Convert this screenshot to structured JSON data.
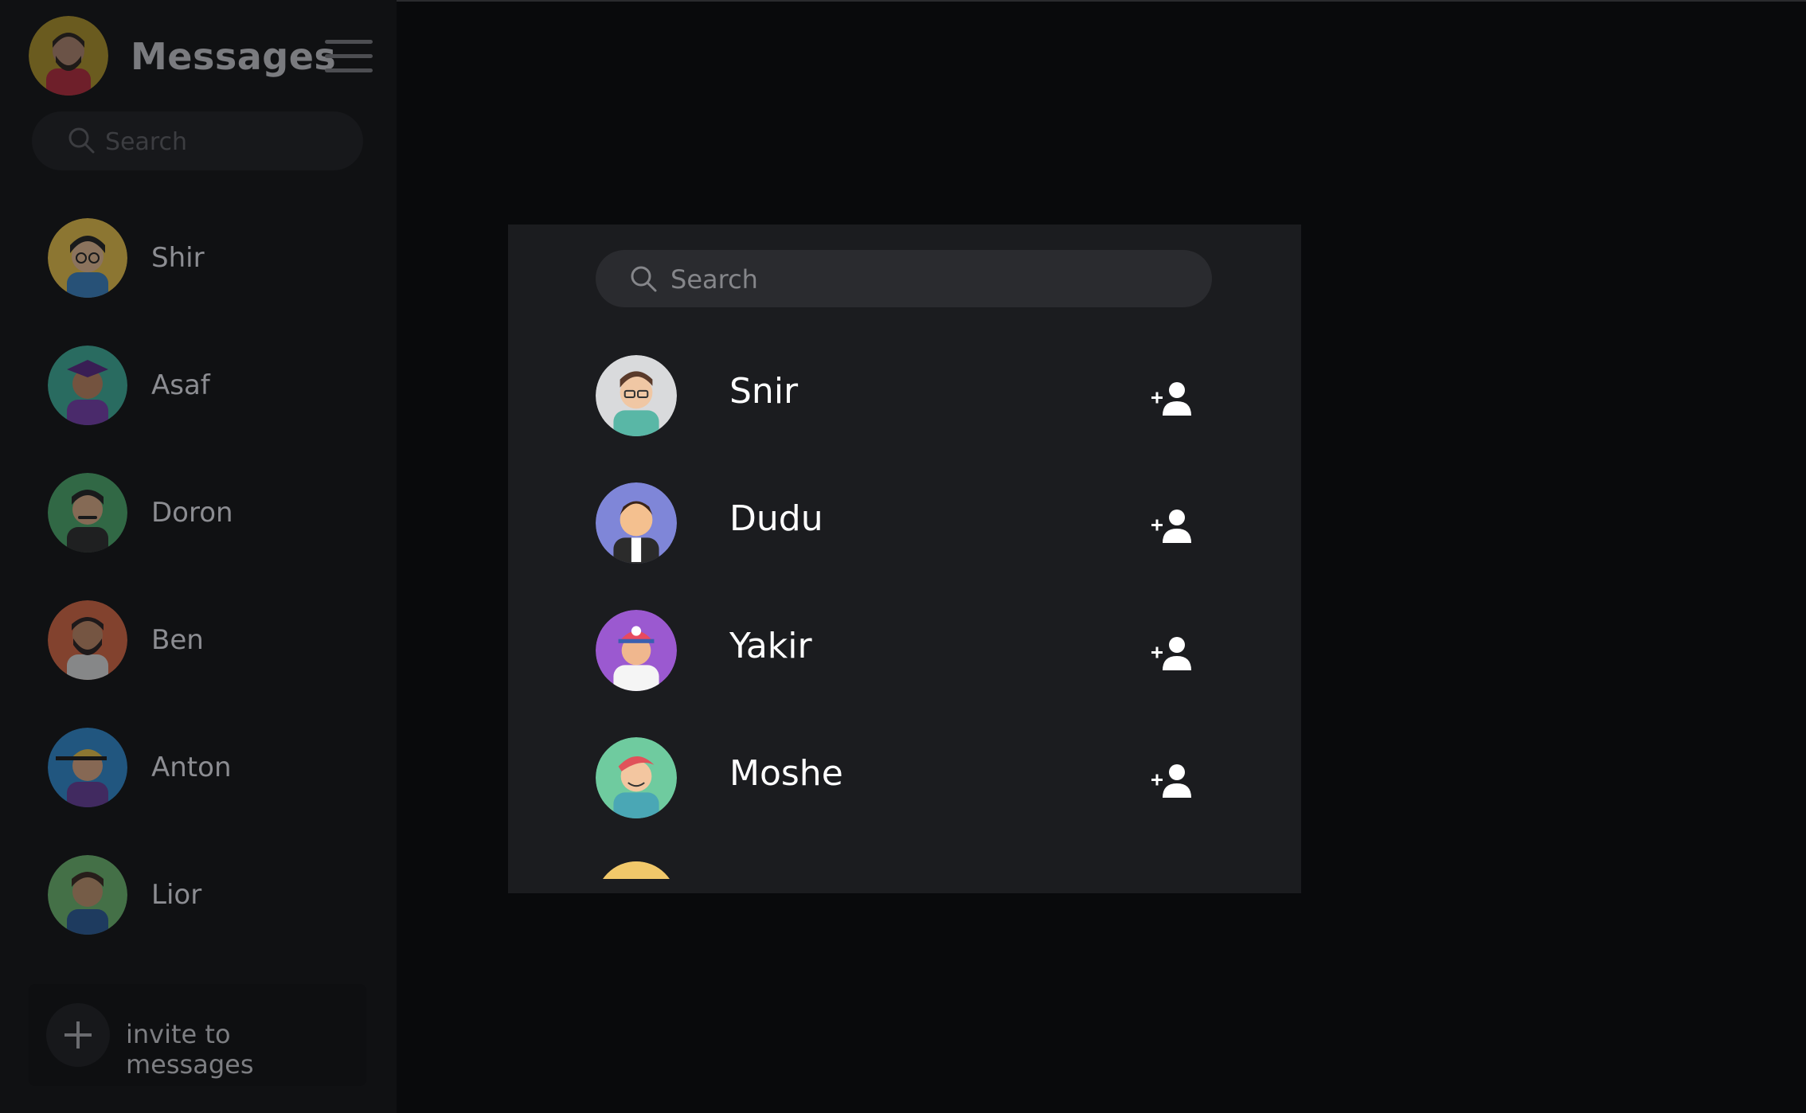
{
  "sidebar": {
    "title": "Messages",
    "search_placeholder": "Search",
    "contacts": [
      {
        "name": "Shir",
        "avatar_bg": "#f2c94c"
      },
      {
        "name": "Asaf",
        "avatar_bg": "#3fb59f"
      },
      {
        "name": "Doron",
        "avatar_bg": "#4caf6e"
      },
      {
        "name": "Ben",
        "avatar_bg": "#e06a45"
      },
      {
        "name": "Anton",
        "avatar_bg": "#2f8fd8"
      },
      {
        "name": "Lior",
        "avatar_bg": "#6fbf73"
      }
    ],
    "invite_label": "invite to messages"
  },
  "modal": {
    "search_placeholder": "Search",
    "users": [
      {
        "name": "Snir",
        "avatar_bg": "#d9dadc"
      },
      {
        "name": "Dudu",
        "avatar_bg": "#7f86d8"
      },
      {
        "name": "Yakir",
        "avatar_bg": "#9b59d0"
      },
      {
        "name": "Moshe",
        "avatar_bg": "#6fcb9f"
      }
    ]
  }
}
